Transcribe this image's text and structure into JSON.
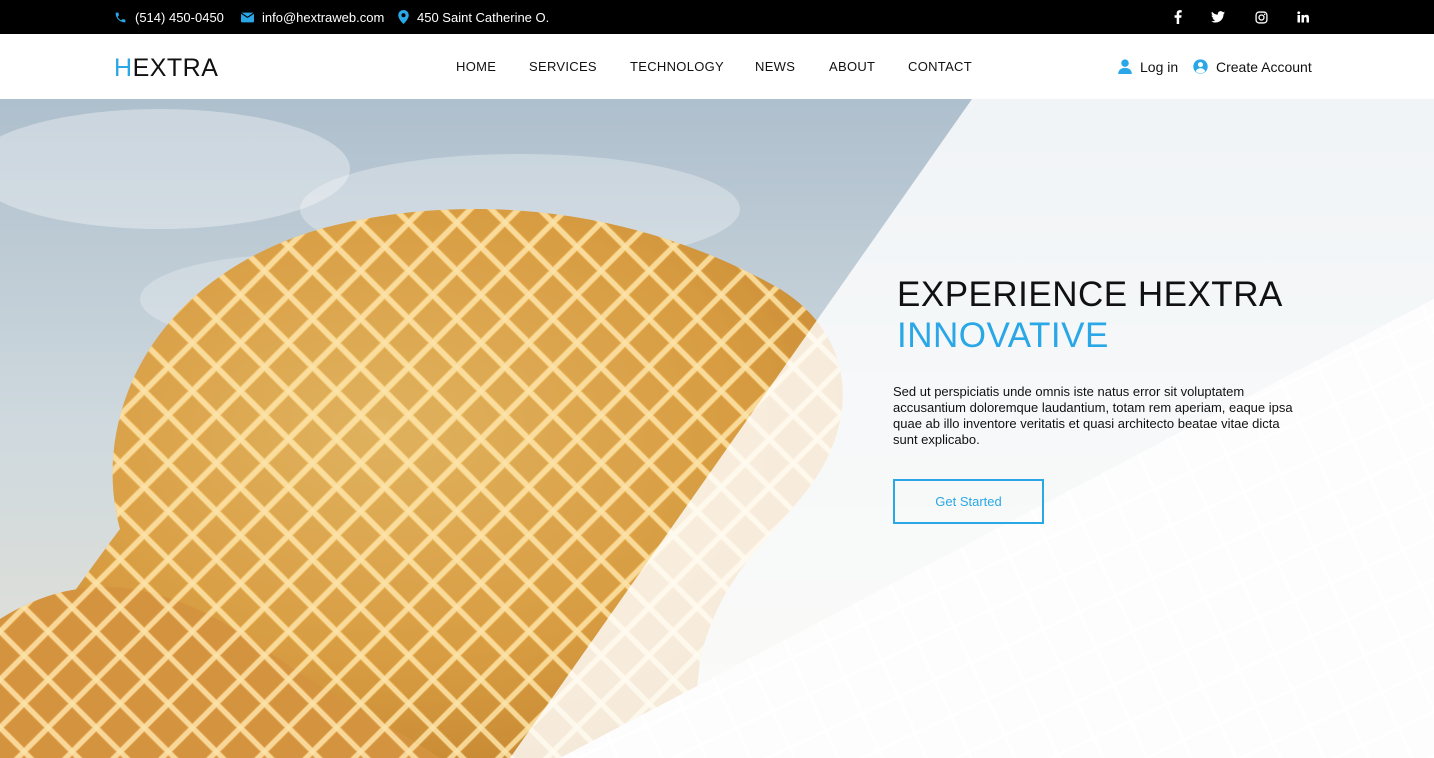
{
  "topbar": {
    "phone": "(514) 450-0450",
    "email": "info@hextraweb.com",
    "address": "450 Saint Catherine O.",
    "social": [
      "facebook-icon",
      "twitter-icon",
      "instagram-icon",
      "linkedin-icon"
    ]
  },
  "brand": {
    "logo_first": "H",
    "logo_rest": "EXTRA",
    "accent_color": "#2aa7e6"
  },
  "nav": {
    "items": [
      {
        "label": "HOME"
      },
      {
        "label": "SERVICES"
      },
      {
        "label": "TECHNOLOGY"
      },
      {
        "label": "NEWS"
      },
      {
        "label": "ABOUT"
      },
      {
        "label": "CONTACT"
      }
    ]
  },
  "account": {
    "login": "Log in",
    "create": "Create Account"
  },
  "hero": {
    "headline_line1": "EXPERIENCE HEXTRA",
    "headline_line2": "INNOVATIVE",
    "description": "Sed ut perspiciatis unde omnis iste natus error sit voluptatem accusantium doloremque laudantium, totam rem aperiam, eaque ipsa quae ab illo inventore veritatis et quasi architecto beatae vitae dicta sunt explicabo.",
    "cta_label": "Get Started"
  }
}
